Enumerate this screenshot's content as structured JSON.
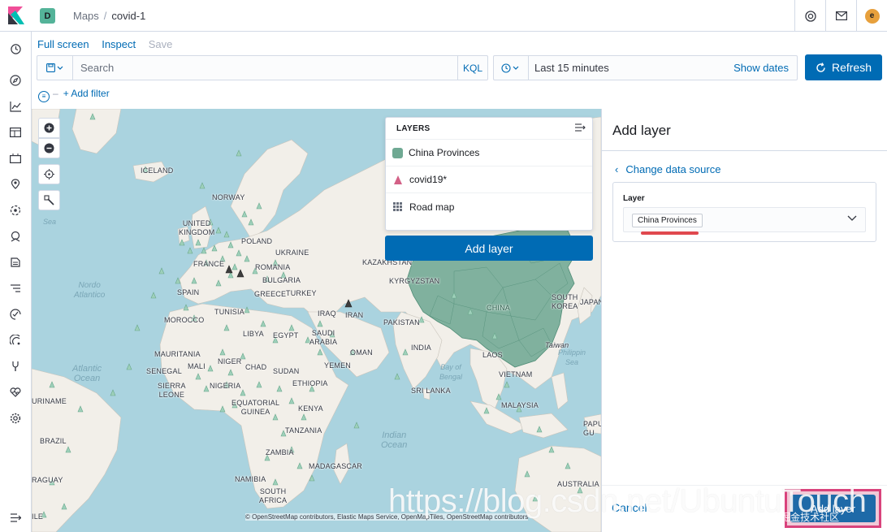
{
  "header": {
    "space_initial": "D",
    "breadcrumbs": [
      "Maps",
      "covid-1"
    ],
    "avatar_initial": "e"
  },
  "menu": {
    "full_screen": "Full screen",
    "inspect": "Inspect",
    "save": "Save"
  },
  "query": {
    "placeholder": "Search",
    "language": "KQL"
  },
  "time": {
    "range": "Last 15 minutes",
    "show_dates": "Show dates",
    "refresh": "Refresh"
  },
  "filters": {
    "add_filter": "+ Add filter"
  },
  "map": {
    "labels": {
      "iceland": "ICELAND",
      "norway": "NORWAY",
      "uk": "UNITED\nKINGDOM",
      "poland": "POLAND",
      "ukraine": "UKRAINE",
      "france": "FRANCE",
      "romania": "ROMANIA",
      "kazakhstan": "KAZAKHSTAN",
      "bulgaria": "BULGARIA",
      "kyrgyzstan": "KYRGYZSTAN",
      "spain": "SPAIN",
      "greece": "GREECE",
      "turkey": "TURKEY",
      "tunisia": "TUNISIA",
      "iraq": "IRAQ",
      "iran": "IRAN",
      "morocco": "MOROCCO",
      "libya": "LIBYA",
      "egypt": "EGYPT",
      "saudi": "SAUDI\nARABIA",
      "pakistan": "PAKISTAN",
      "mauritania": "MAURITANIA",
      "niger": "NIGER",
      "chad": "CHAD",
      "sudan": "SUDAN",
      "yemen": "YEMEN",
      "oman": "OMAN",
      "india": "INDIA",
      "laos": "LAOS",
      "vietnam": "VIETNAM",
      "mali": "MALI",
      "senegal": "SENEGAL",
      "nigeria": "NIGERIA",
      "ethiopia": "ETHIOPIA",
      "sierra": "SIERRA\nLEONE",
      "srilanka": "SRI LANKA",
      "malaysia": "MALAYSIA",
      "equatorial": "EQUATORIAL\nGUINEA",
      "kenya": "KENYA",
      "suriname": "URINAME",
      "tanzania": "TANZANIA",
      "brazil": "BRAZIL",
      "zambia": "ZAMBIA",
      "madagascar": "MADAGASCAR",
      "paraguay": "RAGUAY",
      "namibia": "NAMIBIA",
      "southafrica": "SOUTH\nAFRICA",
      "australia": "AUSTRALIA",
      "chile": "ILE",
      "japan": "JAPAN",
      "southkorea": "SOUTH\nKOREA",
      "taiwan": "Taiwan",
      "papua": "PAPU\nGU",
      "china": "CHINA"
    },
    "oceans": {
      "nord_atl": "Nordo\nAtlantico",
      "atlantic": "Atlantic\nOcean",
      "indian": "Indian\nOcean",
      "bengal": "Bay of\nBengal",
      "philippine": "Philippin\nSea",
      "sea_no": "Sea"
    },
    "attribution": "© OpenStreetMap contributors, Elastic Maps Service, OpenMapTiles, OpenStreetMap contributors"
  },
  "layers_panel": {
    "title": "LAYERS",
    "items": [
      {
        "name": "China Provinces",
        "type": "fill",
        "color": "#6fa993"
      },
      {
        "name": "covid19*",
        "type": "points",
        "color": "#d36086"
      },
      {
        "name": "Road map",
        "type": "tiles"
      }
    ],
    "add_layer": "Add layer"
  },
  "add_layer_flyout": {
    "title": "Add layer",
    "change_source": "Change data source",
    "layer_label": "Layer",
    "layer_value": "China Provinces",
    "cancel": "Cancel",
    "add_button": "Add layer"
  },
  "watermark": {
    "url": "https://blog.csdn.net/UbuntuTouch",
    "credit": "@稀土掘金技术社区"
  },
  "colors": {
    "accent": "#006bb4",
    "china_fill": "#6fa993",
    "ocean": "#aad3df",
    "land": "#f2efe9",
    "highlight": "#d9437c"
  }
}
